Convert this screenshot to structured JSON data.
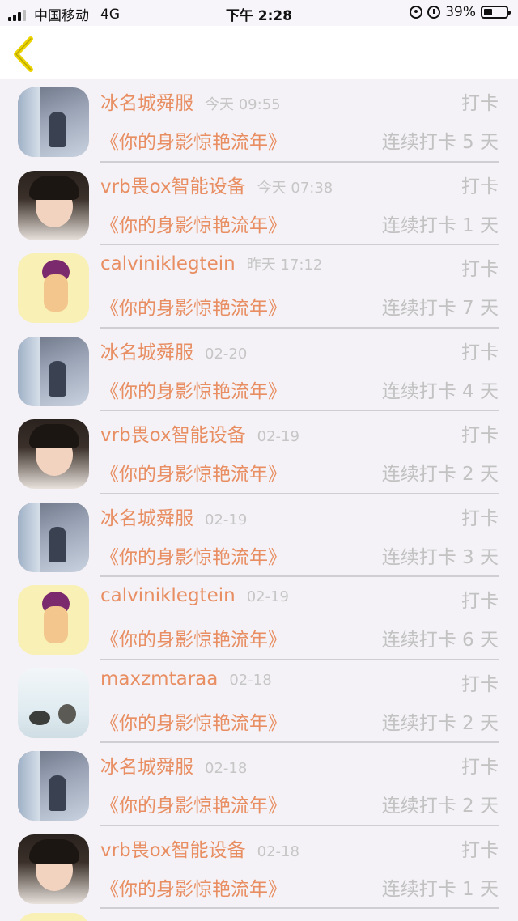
{
  "status_bar": {
    "carrier": "中国移动",
    "network": "4G",
    "time": "下午 2:28",
    "battery": "39%",
    "battery_level": 0.39
  },
  "nav": {
    "back_icon": "chevron-left-icon",
    "accent_color": "#ecd400"
  },
  "rows": [
    {
      "avatar": "a",
      "user": "冰名城舜服",
      "time": "今天 09:55",
      "checkin": "打卡",
      "book": "《你的身影惊艳流年》",
      "streak": "连续打卡 5 天"
    },
    {
      "avatar": "b",
      "user": "vrb畏ox智能设备",
      "time": "今天 07:38",
      "checkin": "打卡",
      "book": "《你的身影惊艳流年》",
      "streak": "连续打卡 1 天"
    },
    {
      "avatar": "c",
      "user": "calviniklegtein",
      "time": "昨天 17:12",
      "checkin": "打卡",
      "book": "《你的身影惊艳流年》",
      "streak": "连续打卡 7 天"
    },
    {
      "avatar": "a",
      "user": "冰名城舜服",
      "time": "02-20",
      "checkin": "打卡",
      "book": "《你的身影惊艳流年》",
      "streak": "连续打卡 4 天"
    },
    {
      "avatar": "b",
      "user": "vrb畏ox智能设备",
      "time": "02-19",
      "checkin": "打卡",
      "book": "《你的身影惊艳流年》",
      "streak": "连续打卡 2 天"
    },
    {
      "avatar": "a",
      "user": "冰名城舜服",
      "time": "02-19",
      "checkin": "打卡",
      "book": "《你的身影惊艳流年》",
      "streak": "连续打卡 3 天"
    },
    {
      "avatar": "c",
      "user": "calviniklegtein",
      "time": "02-19",
      "checkin": "打卡",
      "book": "《你的身影惊艳流年》",
      "streak": "连续打卡 6 天"
    },
    {
      "avatar": "d",
      "user": "maxzmtaraa",
      "time": "02-18",
      "checkin": "打卡",
      "book": "《你的身影惊艳流年》",
      "streak": "连续打卡 2 天"
    },
    {
      "avatar": "a",
      "user": "冰名城舜服",
      "time": "02-18",
      "checkin": "打卡",
      "book": "《你的身影惊艳流年》",
      "streak": "连续打卡 2 天"
    },
    {
      "avatar": "b",
      "user": "vrb畏ox智能设备",
      "time": "02-18",
      "checkin": "打卡",
      "book": "《你的身影惊艳流年》",
      "streak": "连续打卡 1 天"
    }
  ]
}
